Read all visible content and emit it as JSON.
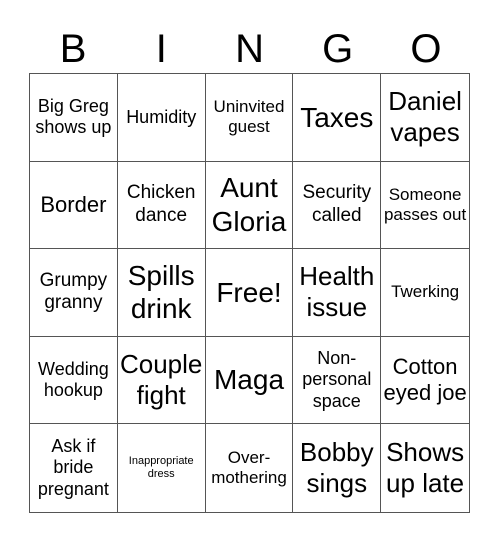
{
  "header": [
    "B",
    "I",
    "N",
    "G",
    "O"
  ],
  "cells": [
    {
      "text": "Big Greg shows up",
      "size": "s18"
    },
    {
      "text": "Humidity",
      "size": "s18"
    },
    {
      "text": "Uninvited guest",
      "size": "s17"
    },
    {
      "text": "Taxes",
      "size": "s28"
    },
    {
      "text": "Daniel vapes",
      "size": "s26"
    },
    {
      "text": "Border",
      "size": "s21"
    },
    {
      "text": "Chicken dance",
      "size": "s19"
    },
    {
      "text": "Aunt Gloria",
      "size": "s28"
    },
    {
      "text": "Security called",
      "size": "s19"
    },
    {
      "text": "Someone passes out",
      "size": "s17"
    },
    {
      "text": "Grumpy granny",
      "size": "s19"
    },
    {
      "text": "Spills drink",
      "size": "s28"
    },
    {
      "text": "Free!",
      "size": "s28"
    },
    {
      "text": "Health issue",
      "size": "s26"
    },
    {
      "text": "Twerking",
      "size": "s17"
    },
    {
      "text": "Wedding hookup",
      "size": "s18"
    },
    {
      "text": "Couple fight",
      "size": "s26"
    },
    {
      "text": "Maga",
      "size": "s28"
    },
    {
      "text": "Non-personal space",
      "size": "s18"
    },
    {
      "text": "Cotton eyed joe",
      "size": "s21"
    },
    {
      "text": "Ask if bride pregnant",
      "size": "s18"
    },
    {
      "text": "Inappropriate dress",
      "size": "s10"
    },
    {
      "text": "Over-mothering",
      "size": "s17"
    },
    {
      "text": "Bobby sings",
      "size": "s26"
    },
    {
      "text": "Shows up late",
      "size": "s26"
    }
  ]
}
